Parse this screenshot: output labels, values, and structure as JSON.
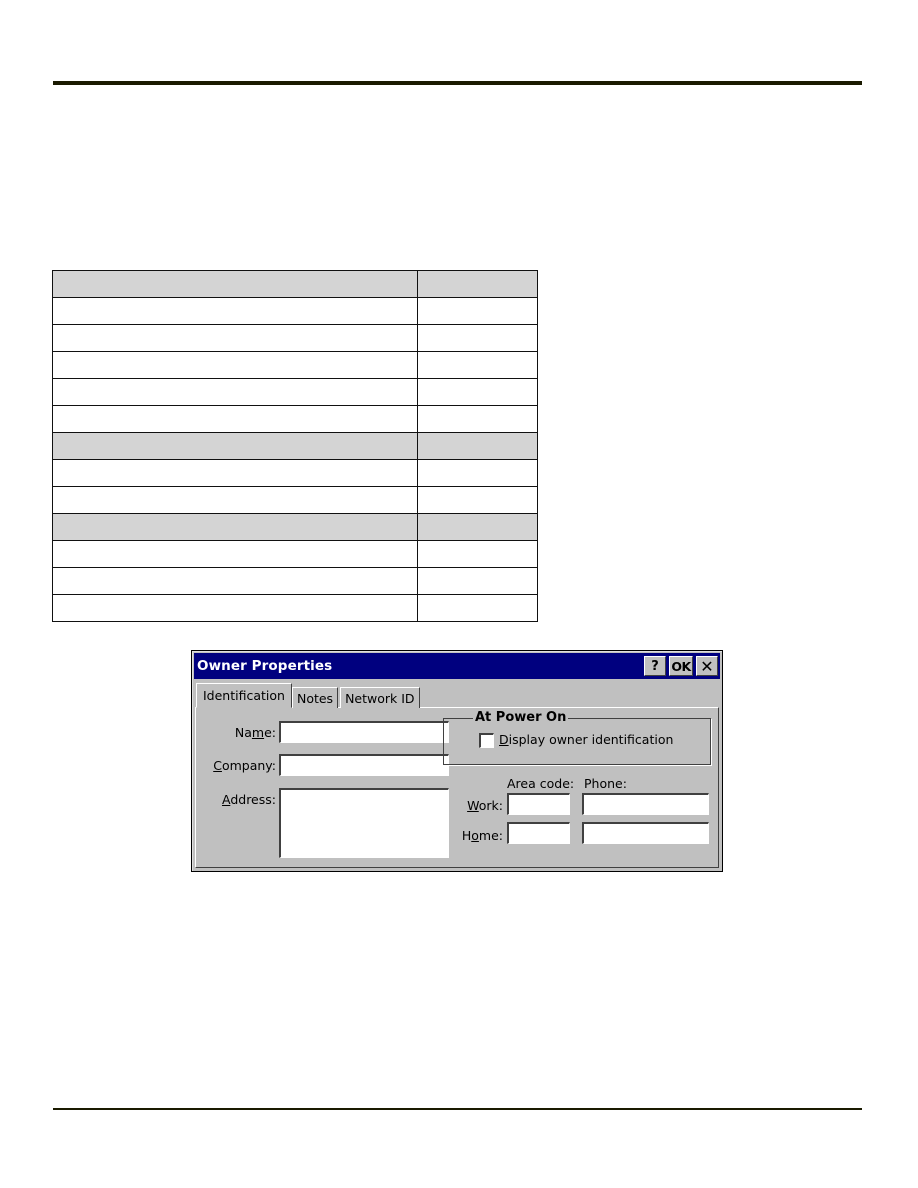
{
  "document": {
    "table": {
      "rows": [
        {
          "shaded": true,
          "cells": [
            "",
            ""
          ]
        },
        {
          "shaded": false,
          "cells": [
            "",
            ""
          ]
        },
        {
          "shaded": false,
          "cells": [
            "",
            ""
          ]
        },
        {
          "shaded": false,
          "cells": [
            "",
            ""
          ]
        },
        {
          "shaded": false,
          "cells": [
            "",
            ""
          ]
        },
        {
          "shaded": false,
          "cells": [
            "",
            ""
          ]
        },
        {
          "shaded": true,
          "cells": [
            "",
            ""
          ]
        },
        {
          "shaded": false,
          "cells": [
            "",
            ""
          ]
        },
        {
          "shaded": false,
          "cells": [
            "",
            ""
          ]
        },
        {
          "shaded": true,
          "cells": [
            "",
            ""
          ]
        },
        {
          "shaded": false,
          "cells": [
            "",
            ""
          ]
        },
        {
          "shaded": false,
          "cells": [
            "",
            ""
          ]
        },
        {
          "shaded": false,
          "cells": [
            "",
            ""
          ]
        }
      ]
    }
  },
  "dialog": {
    "title": "Owner Properties",
    "title_buttons": {
      "help": {
        "label": "?",
        "icon": "help-icon"
      },
      "ok": {
        "label": "OK",
        "icon": "ok-icon"
      },
      "close": {
        "label": "✕",
        "icon": "close-icon"
      }
    },
    "tabs": [
      {
        "label": "Identification",
        "active": true
      },
      {
        "label": "Notes",
        "active": false
      },
      {
        "label": "Network ID",
        "active": false
      }
    ],
    "identification": {
      "name": {
        "label_pre": "Na",
        "label_mnemonic": "m",
        "label_post": "e:",
        "value": ""
      },
      "company": {
        "label_pre": "",
        "label_mnemonic": "C",
        "label_post": "ompany:",
        "value": ""
      },
      "address": {
        "label_pre": "",
        "label_mnemonic": "A",
        "label_post": "ddress:",
        "value": ""
      },
      "power_on_group": {
        "title": "At Power On",
        "checkbox": {
          "label_mnemonic": "D",
          "label_post": "isplay owner identification",
          "checked": false
        }
      },
      "area_code_header": "Area code:",
      "phone_header": "Phone:",
      "work": {
        "label_pre": "",
        "label_mnemonic": "W",
        "label_post": "ork:",
        "area_code": "",
        "phone": ""
      },
      "home": {
        "label_pre": "H",
        "label_mnemonic": "o",
        "label_post": "me:",
        "area_code": "",
        "phone": ""
      }
    }
  },
  "colors": {
    "titlebar": "#00007f",
    "dialog_face": "#c0c0c0",
    "table_shade": "#d4d4d4",
    "rule": "#1a1a00"
  }
}
